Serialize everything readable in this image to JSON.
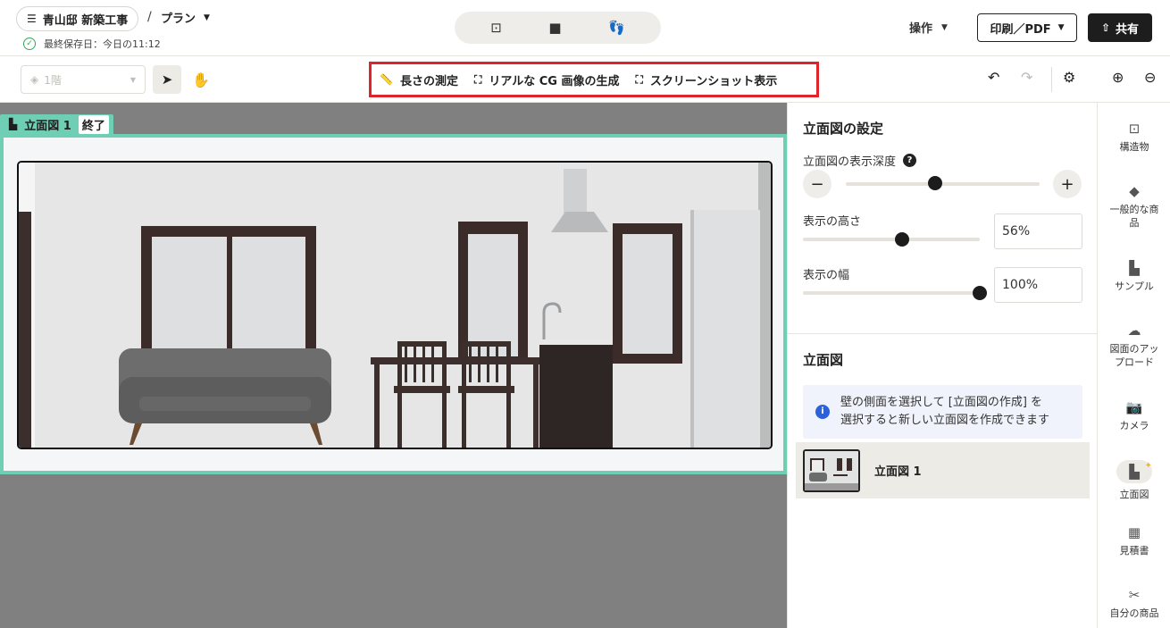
{
  "header": {
    "project_name": "青山邸 新築工事",
    "breadcrumb_sep": "/",
    "plan_label": "プラン",
    "saved_text": "最終保存日：今日の11:12",
    "view_icons": [
      "floorplan-icon",
      "3d-box-icon",
      "walkthrough-footprints-icon"
    ],
    "operations_label": "操作",
    "print_label": "印刷／PDF",
    "share_label": "共有"
  },
  "toolbar": {
    "floor_label": "1階",
    "measure_label": "長さの測定",
    "cg_label": "リアルな CG 画像の生成",
    "screenshot_label": "スクリーンショット表示"
  },
  "canvas": {
    "elevation_tag": "立面図 1",
    "done_label": "終了"
  },
  "panel": {
    "settings_title": "立面図の設定",
    "depth_label": "立面図の表示深度",
    "depth_level": 0.46,
    "height_label": "表示の高さ",
    "height_value": "56%",
    "height_level": 0.56,
    "width_label": "表示の幅",
    "width_value": "100%",
    "width_level": 1.0,
    "elevations_title": "立面図",
    "info_line1": "壁の側面を選択して [立面図の作成] を",
    "info_line2": "選択すると新しい立面図を作成できます",
    "elevation_item": "立面図 1"
  },
  "rail": {
    "items": [
      {
        "label": "構造物",
        "icon": "structure-icon"
      },
      {
        "label": "一般的な商品",
        "icon": "products-icon"
      },
      {
        "label": "サンプル",
        "icon": "sample-house-icon"
      },
      {
        "label": "図面のアップロード",
        "icon": "upload-cloud-icon"
      },
      {
        "label": "カメラ",
        "icon": "camera-icon"
      },
      {
        "label": "立面図",
        "icon": "elevation-icon"
      },
      {
        "label": "見積書",
        "icon": "calculator-icon"
      },
      {
        "label": "自分の商品",
        "icon": "my-products-icon"
      }
    ]
  },
  "colors": {
    "accent_teal": "#6fcfb4",
    "highlight_red": "#e0242b",
    "share_button": "#1d1d1d",
    "info_blue": "#2b62d9"
  }
}
